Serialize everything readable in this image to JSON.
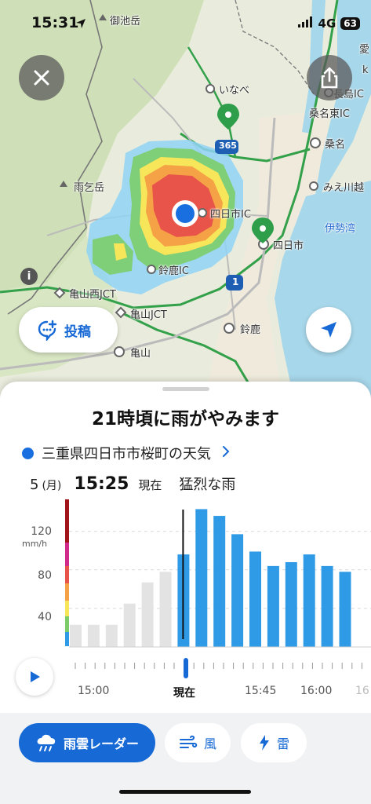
{
  "status_bar": {
    "time": "15:31",
    "network": "4G",
    "battery": "63",
    "icons": [
      "location-arrow-icon",
      "signal-icon",
      "battery-icon"
    ]
  },
  "map": {
    "labels": {
      "miike": "御池岳",
      "inabe": "いなべ",
      "nagashima": "長島IC",
      "kuwana_higashi": "桑名東IC",
      "kuwana": "桑名",
      "amagodake": "雨乞岳",
      "mie_kawagoe": "みえ川越",
      "yokkaichi_ic": "四日市IC",
      "ise_bay": "伊勢湾",
      "yokkaichi": "四日市",
      "suzuka_ic": "鈴鹿IC",
      "kameyama_nishi": "亀山西JCT",
      "kameyama_jct": "亀山JCT",
      "suzuka": "鈴鹿",
      "kameyama": "亀山",
      "route365": "365",
      "route1": "1",
      "edge_a": "愛",
      "edge_k": "k"
    },
    "accent_color": "#1769d6",
    "radar_colors": [
      "#8fd3f5",
      "#7ccd6a",
      "#f7e65a",
      "#f5a145",
      "#e8544a"
    ]
  },
  "buttons": {
    "post_label": "投稿"
  },
  "sheet": {
    "title": "21時頃に雨がやみます",
    "location": "三重県四日市市桜町の天気",
    "day": "5",
    "weekday": "(月)",
    "clock": "15:25",
    "now_label": "現在",
    "condition": "猛烈な雨"
  },
  "chart_data": {
    "type": "bar",
    "ylabel": "mm/h",
    "yticks": [
      "40",
      "80",
      "120"
    ],
    "ylim": [
      0,
      140
    ],
    "past": [
      23,
      23,
      23,
      45,
      67,
      78
    ],
    "forecast": [
      96,
      143,
      136,
      117,
      99,
      84,
      88,
      96,
      84,
      78
    ],
    "now_marker_index": 6,
    "past_color": "#e3e3e3",
    "forecast_color": "#2f9be6"
  },
  "timeline": {
    "labels": [
      "15:00",
      "現在",
      "15:45",
      "16:00",
      "16"
    ]
  },
  "tabs": {
    "radar": "雨雲レーダー",
    "wind": "風",
    "thunder": "雷"
  }
}
